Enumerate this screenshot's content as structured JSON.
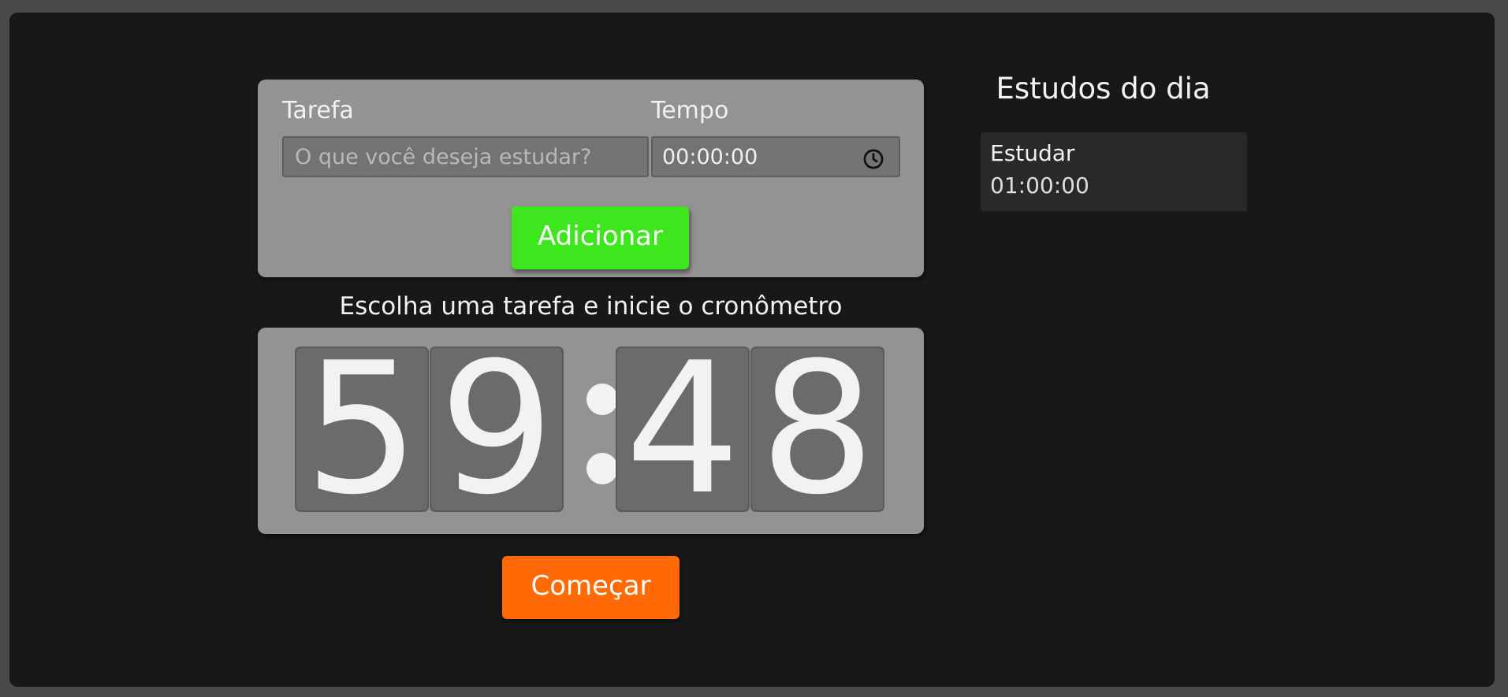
{
  "form": {
    "task_label": "Tarefa",
    "task_placeholder": "O que você deseja estudar?",
    "time_label": "Tempo",
    "time_value": "00:00:00",
    "time_icon": "clock-icon",
    "add_button": "Adicionar"
  },
  "timer": {
    "title": "Escolha uma tarefa e inicie o cronômetro",
    "digits": [
      "5",
      "9",
      "4",
      "8"
    ],
    "start_button": "Começar"
  },
  "sidebar": {
    "title": "Estudos do dia",
    "items": [
      {
        "name": "Estudar",
        "time": "01:00:00"
      }
    ]
  },
  "colors": {
    "background": "#181818",
    "card": "#939393",
    "digit_box": "#6b6b6b",
    "add_button": "#3ee71d",
    "start_button": "#ff6a06",
    "list_item": "#292929"
  }
}
